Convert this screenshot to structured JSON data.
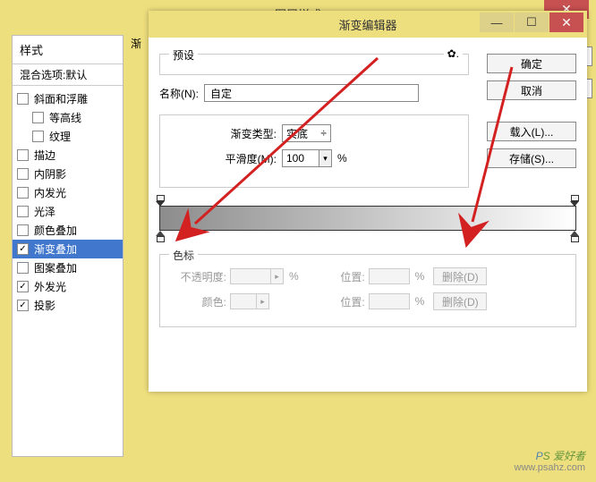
{
  "outer": {
    "title": "图层样式"
  },
  "styles": {
    "header": "样式",
    "sub": "混合选项:默认",
    "items": [
      {
        "label": "斜面和浮雕",
        "checked": false,
        "indent": false
      },
      {
        "label": "等高线",
        "checked": false,
        "indent": true
      },
      {
        "label": "纹理",
        "checked": false,
        "indent": true
      },
      {
        "label": "描边",
        "checked": false,
        "indent": false
      },
      {
        "label": "内阴影",
        "checked": false,
        "indent": false
      },
      {
        "label": "内发光",
        "checked": false,
        "indent": false
      },
      {
        "label": "光泽",
        "checked": false,
        "indent": false
      },
      {
        "label": "颜色叠加",
        "checked": false,
        "indent": false
      },
      {
        "label": "渐变叠加",
        "checked": true,
        "indent": false,
        "selected": true
      },
      {
        "label": "图案叠加",
        "checked": false,
        "indent": false
      },
      {
        "label": "外发光",
        "checked": true,
        "indent": false
      },
      {
        "label": "投影",
        "checked": true,
        "indent": false
      }
    ]
  },
  "right_hint": "渐",
  "inner": {
    "title": "渐变编辑器",
    "preset_label": "预设",
    "gear": "✿.",
    "btn_ok": "确定",
    "btn_cancel": "取消",
    "btn_load": "载入(L)...",
    "btn_save": "存储(S)...",
    "name_label": "名称(N):",
    "name_value": "自定",
    "type_label": "渐变类型:",
    "type_value": "实底",
    "smooth_label": "平滑度(M):",
    "smooth_value": "100",
    "pct": "%",
    "stops_legend": "色标",
    "opacity_label": "不透明度:",
    "position_label": "位置:",
    "color_label": "颜色:",
    "delete_label": "删除(D)"
  },
  "watermark": {
    "brand": "PS 爱好者",
    "url": "www.psahz.com"
  }
}
